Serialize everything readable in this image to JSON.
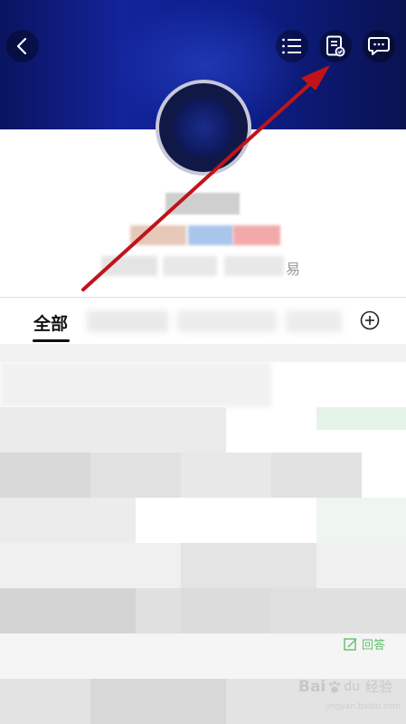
{
  "header": {
    "back_icon": "chevron-left-icon",
    "menu_icon": "list-icon",
    "history_icon": "document-check-icon",
    "message_icon": "chat-bubble-icon"
  },
  "profile": {
    "info_suffix": "易"
  },
  "tabs": {
    "active": "全部",
    "add_icon": "plus-circle-icon"
  },
  "feed": {
    "answer_label": "回答"
  },
  "watermark": {
    "brand_bai": "Bai",
    "brand_du": "du",
    "brand_text": "经验",
    "url": "jingyan.baidu.com"
  },
  "annotation": {
    "arrow_color": "#c0141a"
  }
}
